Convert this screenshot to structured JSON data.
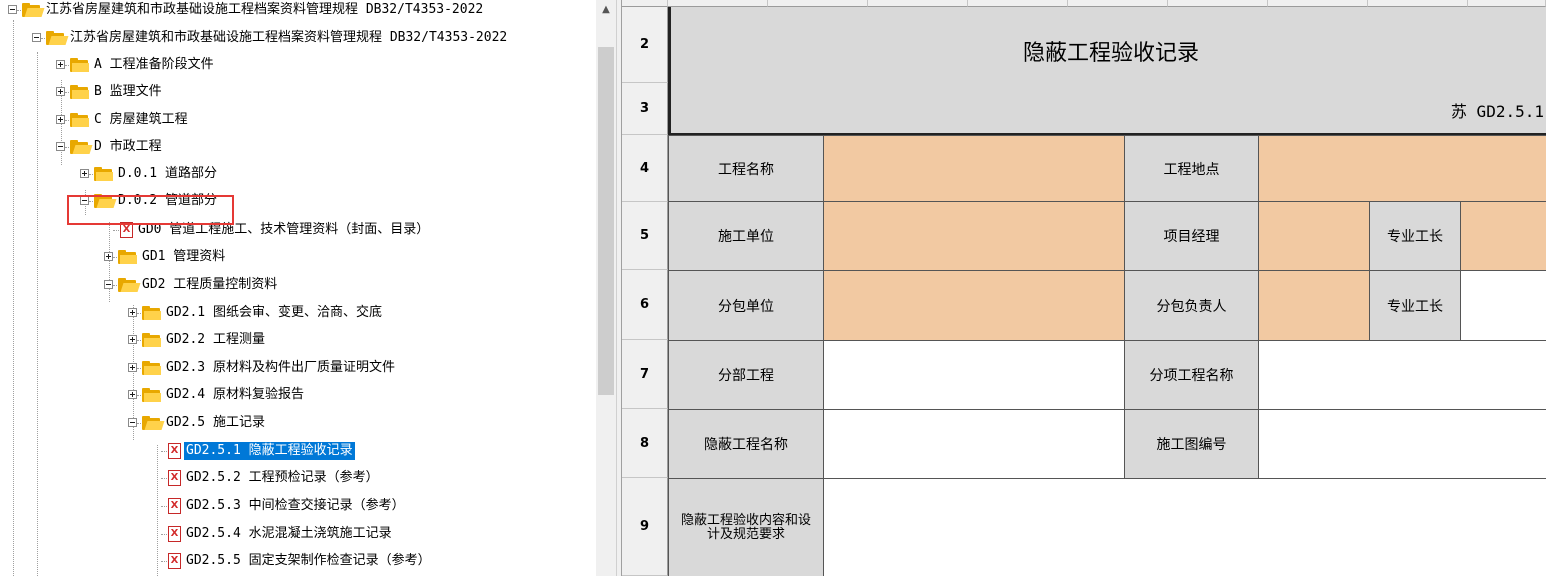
{
  "tree": {
    "nodes": [
      {
        "label": "江苏省房屋建筑和市政基础设施工程档案资料管理规程 DB32/T4353-2022",
        "icon": "folder-open-icon",
        "toggle": "collapse"
      },
      {
        "label": "江苏省房屋建筑和市政基础设施工程档案资料管理规程 DB32/T4353-2022",
        "icon": "folder-open-icon",
        "toggle": "collapse"
      },
      {
        "label": "A 工程准备阶段文件",
        "icon": "folder-icon",
        "toggle": "expand"
      },
      {
        "label": "B 监理文件",
        "icon": "folder-icon",
        "toggle": "expand"
      },
      {
        "label": "C 房屋建筑工程",
        "icon": "folder-icon",
        "toggle": "expand"
      },
      {
        "label": "D 市政工程",
        "icon": "folder-open-icon",
        "toggle": "collapse"
      },
      {
        "label": "D.0.1 道路部分",
        "icon": "folder-icon",
        "toggle": "expand"
      },
      {
        "label": "D.0.2 管道部分",
        "icon": "folder-open-icon",
        "toggle": "collapse"
      },
      {
        "label": "GD0 管道工程施工、技术管理资料（封面、目录）",
        "icon": "excel-file-icon",
        "toggle": "none"
      },
      {
        "label": "GD1 管理资料",
        "icon": "folder-icon",
        "toggle": "expand"
      },
      {
        "label": "GD2 工程质量控制资料",
        "icon": "folder-open-icon",
        "toggle": "collapse"
      },
      {
        "label": "GD2.1 图纸会审、变更、洽商、交底",
        "icon": "folder-icon",
        "toggle": "expand"
      },
      {
        "label": "GD2.2 工程测量",
        "icon": "folder-icon",
        "toggle": "expand"
      },
      {
        "label": "GD2.3 原材料及构件出厂质量证明文件",
        "icon": "folder-icon",
        "toggle": "expand"
      },
      {
        "label": "GD2.4 原材料复验报告",
        "icon": "folder-icon",
        "toggle": "expand"
      },
      {
        "label": "GD2.5 施工记录",
        "icon": "folder-open-icon",
        "toggle": "collapse"
      },
      {
        "label": "GD2.5.1 隐蔽工程验收记录",
        "icon": "excel-file-icon",
        "toggle": "none",
        "selected": true
      },
      {
        "label": "GD2.5.2 工程预检记录（参考）",
        "icon": "excel-file-icon",
        "toggle": "none"
      },
      {
        "label": "GD2.5.3 中间检查交接记录（参考）",
        "icon": "excel-file-icon",
        "toggle": "none"
      },
      {
        "label": "GD2.5.4 水泥混凝土浇筑施工记录",
        "icon": "excel-file-icon",
        "toggle": "none"
      },
      {
        "label": "GD2.5.5 固定支架制作检查记录（参考）",
        "icon": "excel-file-icon",
        "toggle": "none"
      }
    ]
  },
  "scrollbar": {
    "up_arrow": "▲"
  },
  "sheet": {
    "row_numbers": [
      "2",
      "3",
      "4",
      "5",
      "6",
      "7",
      "8",
      "9"
    ],
    "title": "隐蔽工程验收记录",
    "form_code": "苏 GD2.5.1",
    "labels": {
      "project_name": "工程名称",
      "project_location": "工程地点",
      "construction_unit": "施工单位",
      "project_manager": "项目经理",
      "foreman_1": "专业工长",
      "subcontract_unit": "分包单位",
      "subcontract_lead": "分包负责人",
      "foreman_2": "专业工长",
      "division": "分部工程",
      "subitem_name": "分项工程名称",
      "hidden_work_name": "隐蔽工程名称",
      "drawing_no": "施工图编号",
      "inspection_content": "隐蔽工程验收内容和设计及规范要求"
    },
    "colors": {
      "label_fill": "#d9d9d9",
      "input_fill": "#f2c9a2",
      "selection": "#0078d7",
      "highlight_box": "#e53935"
    }
  }
}
